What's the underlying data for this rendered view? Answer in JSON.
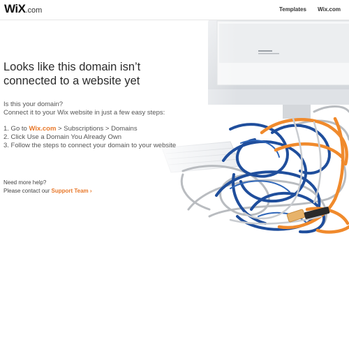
{
  "header": {
    "logo_main": "WiX",
    "logo_suffix": ".com",
    "nav": [
      "Templates",
      "Wix.com"
    ]
  },
  "main": {
    "headline_line1": "Looks like this domain isn’t",
    "headline_line2": "connected to a website yet",
    "intro_line1": "Is this your domain?",
    "intro_line2": "Connect it to your Wix website in just a few easy steps:",
    "step1_prefix": "1. Go to ",
    "step1_link": "Wix.com",
    "step1_suffix": " > Subscriptions > Domains",
    "step2": "2. Click Use a Domain You Already Own",
    "step3": "3. Follow the steps to connect your domain to your website",
    "help_line1": "Need more help?",
    "help_prefix": "Please contact our ",
    "help_link": "Support Team ›"
  },
  "colors": {
    "accent": "#e8782a",
    "cable_blue": "#1f4e9c",
    "cable_orange": "#f08a2c",
    "cable_gray": "#b9bcc0"
  },
  "icons": {
    "illustration": "tangled-cables-and-monitor"
  }
}
